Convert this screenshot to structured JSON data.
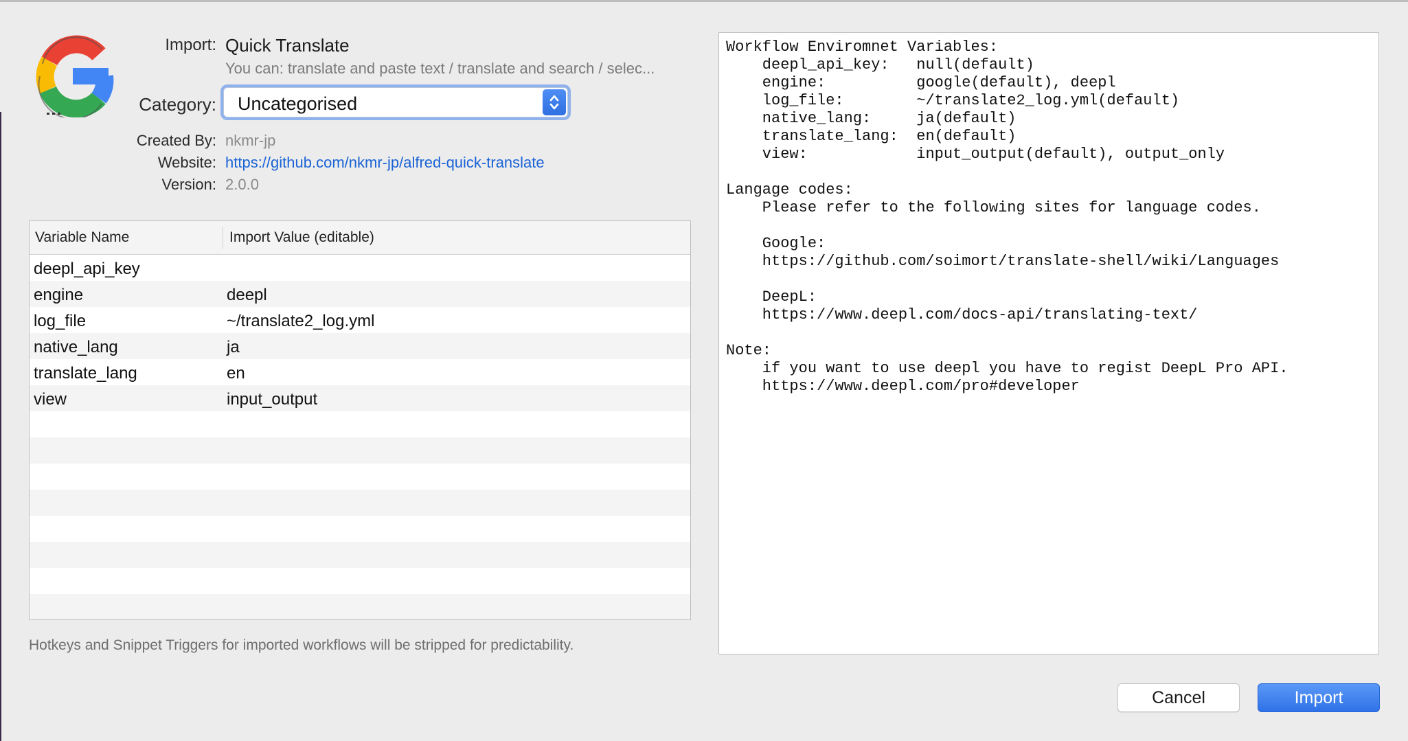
{
  "header": {
    "import_label": "Import:",
    "workflow_name": "Quick Translate",
    "description": "You can: translate and paste text / translate and search / selec...",
    "category_label": "Category:",
    "category_value": "Uncategorised",
    "created_by_label": "Created By:",
    "created_by_value": "nkmr-jp",
    "website_label": "Website:",
    "website_value": "https://github.com/nkmr-jp/alfred-quick-translate",
    "version_label": "Version:",
    "version_value": "2.0.0"
  },
  "table": {
    "columns": [
      "Variable Name",
      "Import Value (editable)"
    ],
    "rows": [
      {
        "name": "deepl_api_key",
        "value": ""
      },
      {
        "name": "engine",
        "value": "deepl"
      },
      {
        "name": "log_file",
        "value": "~/translate2_log.yml"
      },
      {
        "name": "native_lang",
        "value": "ja"
      },
      {
        "name": "translate_lang",
        "value": "en"
      },
      {
        "name": "view",
        "value": "input_output"
      }
    ]
  },
  "footnote": "Hotkeys and Snippet Triggers for imported workflows will be stripped for predictability.",
  "readme": [
    "Workflow Enviromnet Variables:",
    "    deepl_api_key:   null(default)",
    "    engine:          google(default), deepl",
    "    log_file:        ~/translate2_log.yml(default)",
    "    native_lang:     ja(default)",
    "    translate_lang:  en(default)",
    "    view:            input_output(default), output_only",
    "",
    "Langage codes:",
    "    Please refer to the following sites for language codes.",
    "",
    "    Google:",
    "    https://github.com/soimort/translate-shell/wiki/Languages",
    "",
    "    DeepL:",
    "    https://www.deepl.com/docs-api/translating-text/",
    "",
    "Note:",
    "    if you want to use deepl you have to regist DeepL Pro API.",
    "    https://www.deepl.com/pro#developer"
  ],
  "buttons": {
    "cancel": "Cancel",
    "import": "Import"
  },
  "colors": {
    "accent": "#2f72e8",
    "link": "#1a63d6"
  },
  "icons": {
    "app": "google-g-icon",
    "select": "updown-chevron-icon"
  }
}
